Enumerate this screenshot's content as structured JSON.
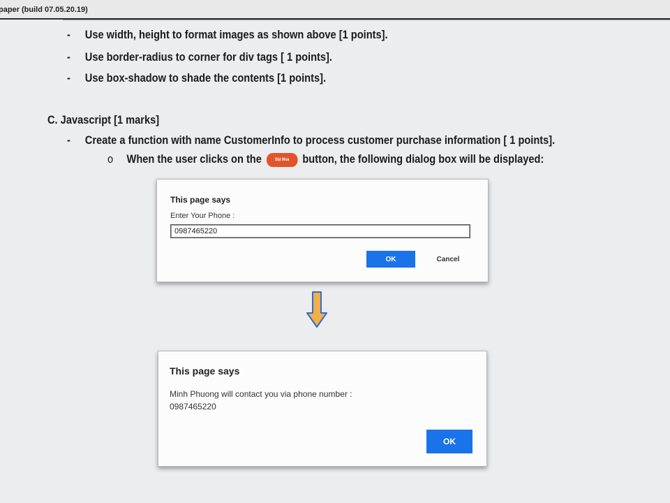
{
  "window": {
    "title": "paper (build 07.05.20.19)"
  },
  "document": {
    "css_items": [
      {
        "marker": "-",
        "text": "Use width, height to format images as shown above [1 points]."
      },
      {
        "marker": "-",
        "text": "Use border-radius to corner for div tags [ 1 points]."
      },
      {
        "marker": "-",
        "text": "Use box-shadow to shade the contents [1 points]."
      }
    ],
    "section_c": {
      "heading": "C. Javascript [1 marks]"
    },
    "js_item": {
      "marker": "-",
      "text": "Create a function with name CustomerInfo to process customer purchase information [ 1 points]."
    },
    "js_sub": {
      "marker": "o",
      "before": "When the user clicks on the",
      "button_label": "Đặt Mua",
      "after": "button, the following dialog box will be displayed:"
    }
  },
  "dialog_prompt": {
    "title": "This page says",
    "message": "Enter Your Phone :",
    "input_value": "0987465220",
    "ok_label": "OK",
    "cancel_label": "Cancel"
  },
  "dialog_alert": {
    "title": "This page says",
    "message_line1": "Minh Phuong will contact you via phone number :",
    "message_line2": "0987465220",
    "ok_label": "OK"
  },
  "icons": {
    "flow_arrow": "arrow-down-icon"
  },
  "colors": {
    "ok_button": "#1a73e8",
    "inline_button": "#e2542a",
    "arrow_fill": "#f0b04a",
    "arrow_stroke": "#2f6fcf"
  }
}
